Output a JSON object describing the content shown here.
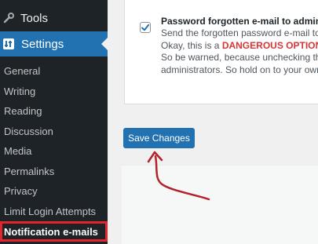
{
  "sidebar": {
    "tools": {
      "label": "Tools",
      "icon": "wrench-icon"
    },
    "settings": {
      "label": "Settings",
      "icon": "settings-sliders-icon"
    },
    "items": [
      {
        "label": "General"
      },
      {
        "label": "Writing"
      },
      {
        "label": "Reading"
      },
      {
        "label": "Discussion"
      },
      {
        "label": "Media"
      },
      {
        "label": "Permalinks"
      },
      {
        "label": "Privacy"
      },
      {
        "label": "Limit Login Attempts"
      },
      {
        "label": "Notification e-mails",
        "current": true
      }
    ]
  },
  "option": {
    "checked": true,
    "title": "Password forgotten e-mail to administ",
    "line1": "Send the forgotten password e-mail to",
    "line2_prefix": "Okay, this is a ",
    "line2_danger": "DANGEROUS OPTION !",
    "line3": "So be warned, because unchecking this",
    "line4": "administrators. So hold on to your own"
  },
  "save_button": {
    "label": "Save Changes"
  },
  "colors": {
    "sidebar_bg": "#1d2327",
    "accent": "#2271b1",
    "danger": "#d63638",
    "highlight_outline": "#e3262e",
    "annotation_arrow": "#b3222b"
  }
}
